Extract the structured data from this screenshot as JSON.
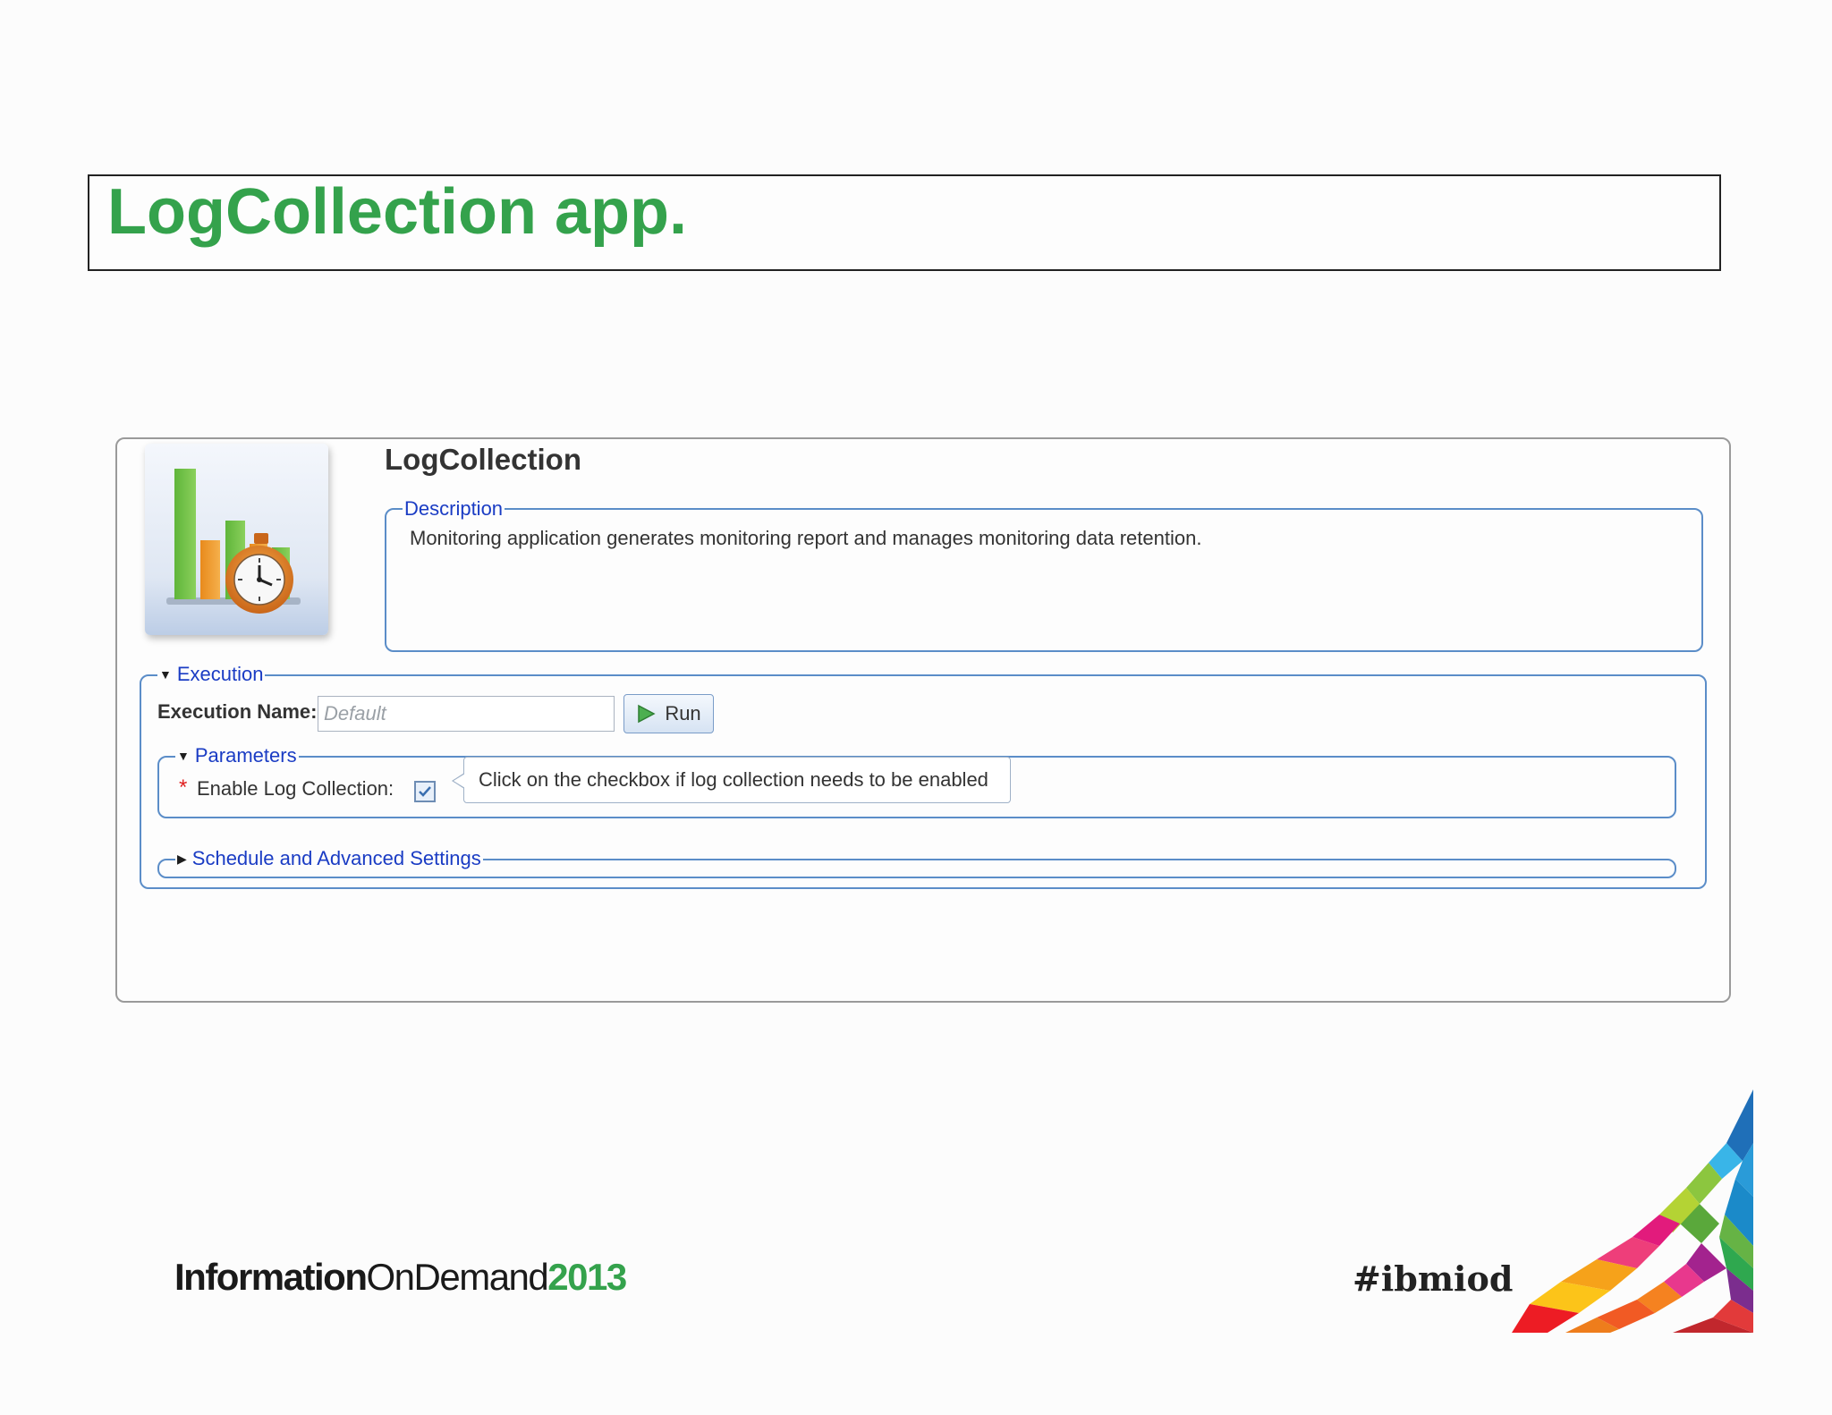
{
  "slide": {
    "title": "LogCollection app."
  },
  "app": {
    "name": "LogCollection",
    "icon": "monitoring-chart-clock-icon",
    "description_legend": "Description",
    "description": "Monitoring application generates monitoring report and manages monitoring data retention."
  },
  "execution": {
    "legend": "Execution",
    "name_label": "Execution Name:",
    "name_value": "",
    "name_placeholder": "Default",
    "run_label": "Run",
    "run_icon": "play-icon"
  },
  "parameters": {
    "legend": "Parameters",
    "required_marker": "*",
    "enable_label": "Enable Log Collection:",
    "enable_checked": true,
    "tooltip": "Click on the checkbox if log collection needs to be enabled"
  },
  "schedule": {
    "legend": "Schedule and Advanced Settings",
    "expanded": false
  },
  "footer": {
    "logo_part1": "Information",
    "logo_part2": "OnDemand",
    "logo_year": "2013",
    "hashtag": "#ibmiod"
  },
  "colors": {
    "title_green": "#34a24c",
    "legend_blue": "#1a3cc4",
    "group_border": "#5b8dc8",
    "required_red": "#e02020"
  }
}
